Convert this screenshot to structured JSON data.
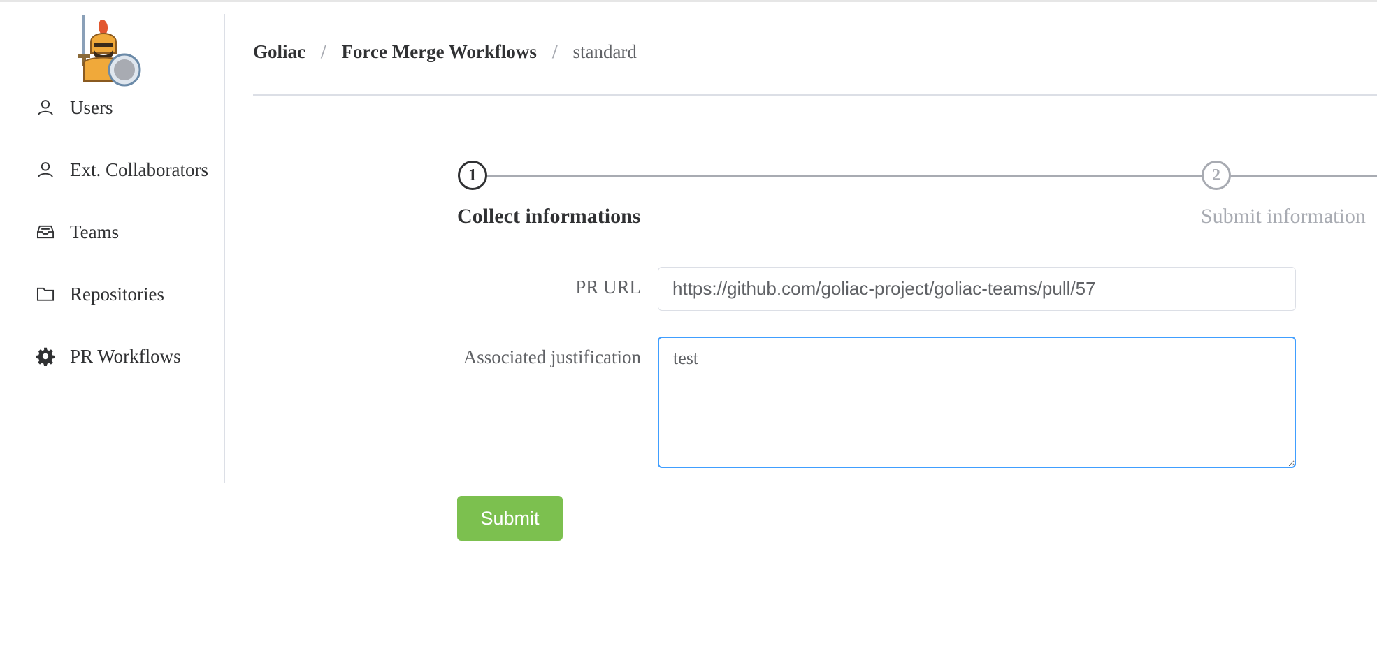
{
  "app": {
    "logo_icon": "knight-logo-icon"
  },
  "sidebar": {
    "items": [
      {
        "label": "Users",
        "icon": "user-icon"
      },
      {
        "label": "Ext. Collaborators",
        "icon": "user-icon"
      },
      {
        "label": "Teams",
        "icon": "inbox-icon"
      },
      {
        "label": "Repositories",
        "icon": "folder-icon"
      },
      {
        "label": "PR Workflows",
        "icon": "gear-icon"
      }
    ]
  },
  "breadcrumb": {
    "items": [
      "Goliac",
      "Force Merge Workflows",
      "standard"
    ],
    "separator": "/"
  },
  "steps": [
    {
      "number": "1",
      "title": "Collect informations",
      "active": true
    },
    {
      "number": "2",
      "title": "Submit information",
      "active": false
    }
  ],
  "form": {
    "pr_url_label": "PR URL",
    "pr_url_value": "https://github.com/goliac-project/goliac-teams/pull/57",
    "justification_label": "Associated justification",
    "justification_value": "test",
    "submit_label": "Submit"
  },
  "colors": {
    "accent": "#409eff",
    "submit": "#7cc04f",
    "inactive": "#a8abb2",
    "text": "#303133"
  }
}
